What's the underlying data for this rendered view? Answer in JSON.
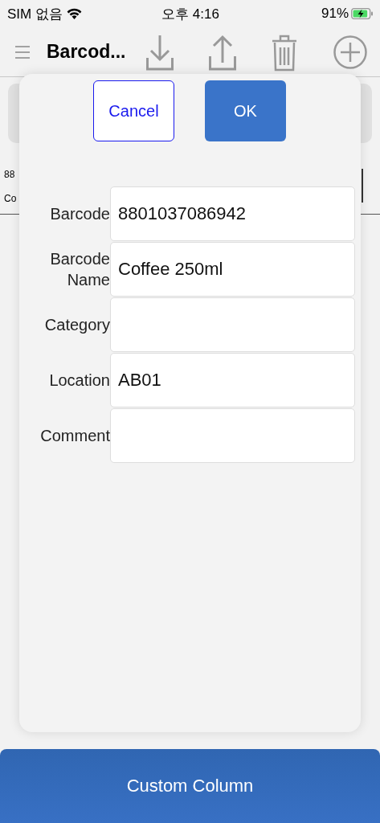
{
  "status_bar": {
    "carrier": "SIM 없음",
    "time": "오후 4:16",
    "battery": "91%",
    "charging": true
  },
  "nav": {
    "title": "Barcod..."
  },
  "background": {
    "row_texts": [
      "88",
      "Co"
    ]
  },
  "dialog": {
    "buttons": [
      {
        "label": "Cancel",
        "kind": "secondary"
      },
      {
        "label": "OK",
        "kind": "primary"
      }
    ],
    "fields": [
      {
        "label": "Barcode",
        "value": "8801037086942"
      },
      {
        "label": "Barcode Name",
        "value": "Coffee 250ml"
      },
      {
        "label": "Category"
      },
      {
        "label": "Location",
        "value": "AB01"
      },
      {
        "label": "Comment"
      }
    ]
  },
  "bottom_button": {
    "label": "Custom Column"
  }
}
